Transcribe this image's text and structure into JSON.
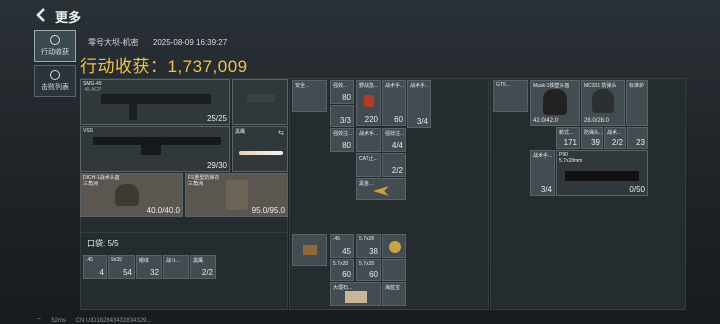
{
  "header": {
    "title": "更多"
  },
  "sidebar": [
    {
      "label": "行动收获",
      "active": true
    },
    {
      "label": "击败列表",
      "active": false
    }
  ],
  "meta": {
    "map": "零号大坝-机密",
    "datetime": "2025-08-09 16:39:27"
  },
  "harvest": {
    "label": "行动收获：",
    "value": "1,737,009"
  },
  "weapons": {
    "smg": {
      "name": "SMG-45",
      "ammo": ".45 ACP",
      "count": "25/25"
    },
    "vss": {
      "name": "VSS",
      "count": "29/30"
    },
    "melee": {
      "name": "黑鹰"
    },
    "helmet": {
      "name": "DICH-1战术头盔\n三角洲",
      "durability": "40.0/40.0"
    },
    "armor": {
      "name": "FS重型防弹衣\n三角洲",
      "durability": "95.0/95.0"
    }
  },
  "pockets": {
    "label": "口袋: 5/5",
    "items": [
      {
        "name": ".45",
        "count": "4"
      },
      {
        "name": "9x39",
        "count": "54"
      },
      {
        "name": "眼体",
        "count": "32"
      },
      {
        "name": "战斗...",
        "count": ""
      },
      {
        "name": "黑鹰",
        "count": "2/2"
      }
    ]
  },
  "backpack_items": [
    {
      "name": "安全...",
      "count": "80"
    },
    {
      "name": "强效...",
      "count": "3/3"
    },
    {
      "name": "野战急...",
      "count": "220"
    },
    {
      "name": "战术手...",
      "count": "60"
    },
    {
      "name": "战术手...",
      "count": "3/4"
    },
    {
      "name": "强效注...",
      "count": "80"
    },
    {
      "name": "战术手...",
      "count": "4/4"
    },
    {
      "name": "强效注...",
      "count": "80"
    },
    {
      "name": "CAT止...",
      "count": "2/2"
    },
    {
      "name": "黑金...",
      "count": ""
    }
  ],
  "right_items": [
    {
      "name": "GT5...",
      "count": ""
    },
    {
      "name": "Mask-1铁壁头盔",
      "durability": "42.0/42.0"
    },
    {
      "name": "MC201 防弹头",
      "durability": "28.0/28.0"
    },
    {
      "name": "标准护",
      "count": ""
    },
    {
      "name": "新式...",
      "count": "171"
    },
    {
      "name": "防弹头...",
      "count": "39"
    },
    {
      "name": "战术...",
      "count": "2/2"
    },
    {
      "name": "...",
      "count": "23"
    },
    {
      "name": "战术手...",
      "count": "3/4"
    },
    {
      "name": "P90",
      "ammo": "5.7x28mm",
      "count": "0/50"
    }
  ],
  "bottom_items": [
    {
      "name": ".45",
      "count": "45"
    },
    {
      "name": "5.7x28",
      "count": "38"
    },
    {
      "name": "5.7x28",
      "count": "60"
    },
    {
      "name": "5.7x28",
      "count": "60"
    },
    {
      "name": "大理石...",
      "count": ""
    },
    {
      "name": "海蓝宝",
      "count": ""
    }
  ],
  "status": {
    "ping": "52ms",
    "uid": "CN UID182843432834329..."
  }
}
